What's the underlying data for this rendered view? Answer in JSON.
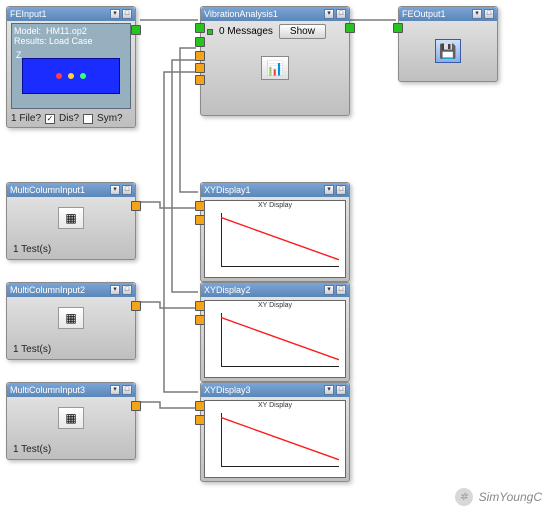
{
  "nodes": {
    "feinput": {
      "title": "FEInput1",
      "info_model_label": "Model:",
      "info_model_value": "HM11.op2",
      "info_results_label": "Results:",
      "info_results_value": "Load Case",
      "axis_label": "Z",
      "file_count": "1 File?",
      "checkbox_dis": "Dis?",
      "checkbox_sym": "Sym?"
    },
    "vibration": {
      "title": "VibrationAnalysis1",
      "messages": "0 Messages",
      "show_btn": "Show"
    },
    "feoutput": {
      "title": "FEOutput1"
    },
    "mci1": {
      "title": "MultiColumnInput1",
      "status": "1 Test(s)"
    },
    "mci2": {
      "title": "MultiColumnInput2",
      "status": "1 Test(s)"
    },
    "mci3": {
      "title": "MultiColumnInput3",
      "status": "1 Test(s)"
    },
    "xy1": {
      "title": "XYDisplay1",
      "plot_title": "XY Display"
    },
    "xy2": {
      "title": "XYDisplay2",
      "plot_title": "XY Display"
    },
    "xy3": {
      "title": "XYDisplay3",
      "plot_title": "XY Display"
    }
  },
  "watermark": "SimYoungC",
  "chart_data": [
    {
      "type": "line",
      "title": "XY Display",
      "x": [
        0,
        100
      ],
      "y": [
        100,
        10
      ],
      "xlim": [
        0,
        100
      ],
      "ylim": [
        0,
        100
      ],
      "series_color": "#ff0000"
    },
    {
      "type": "line",
      "title": "XY Display",
      "x": [
        0,
        100
      ],
      "y": [
        100,
        10
      ],
      "xlim": [
        0,
        100
      ],
      "ylim": [
        0,
        100
      ],
      "series_color": "#ff0000"
    },
    {
      "type": "line",
      "title": "XY Display",
      "x": [
        0,
        100
      ],
      "y": [
        100,
        10
      ],
      "xlim": [
        0,
        100
      ],
      "ylim": [
        0,
        100
      ],
      "series_color": "#ff0000"
    }
  ]
}
